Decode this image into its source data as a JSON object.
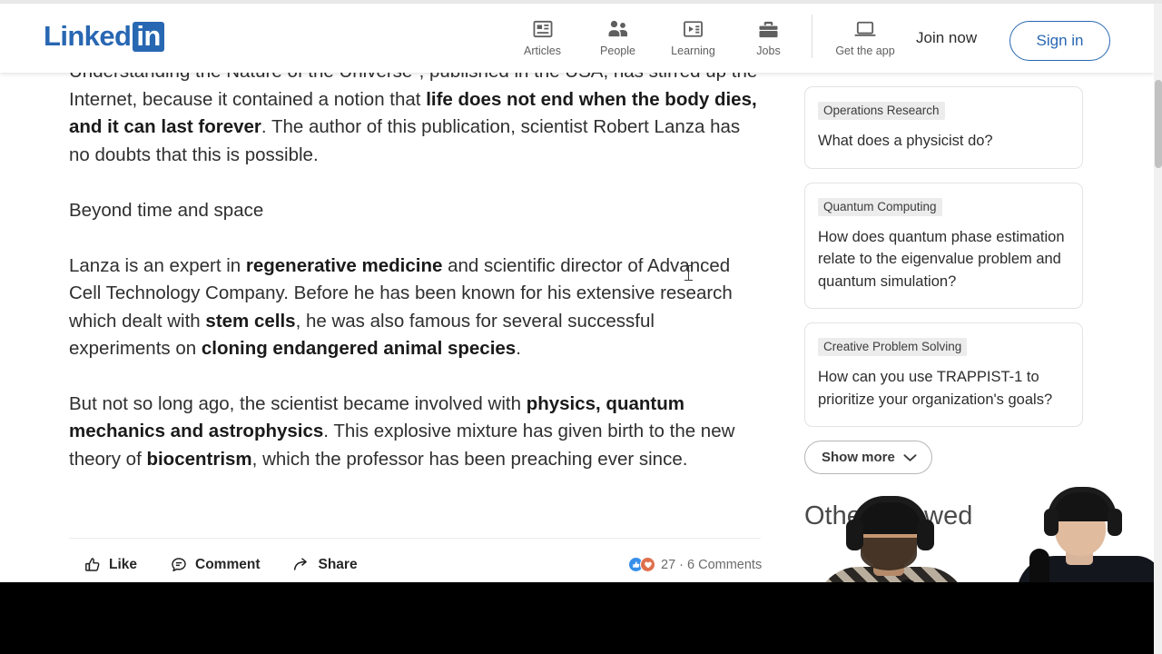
{
  "brand": {
    "word": "Linked",
    "badge": "in"
  },
  "nav": {
    "items": [
      {
        "label": "Articles",
        "icon": "articles-icon"
      },
      {
        "label": "People",
        "icon": "people-icon"
      },
      {
        "label": "Learning",
        "icon": "learning-icon"
      },
      {
        "label": "Jobs",
        "icon": "jobs-icon"
      }
    ],
    "get_the_app": {
      "label": "Get the app",
      "icon": "laptop-icon"
    },
    "join_now": "Join now",
    "sign_in": "Sign in"
  },
  "article": {
    "paragraph_1": {
      "part_1": "Understanding the Nature of the Universe\", published in the USA, has stirred up the Internet, because it contained a notion that ",
      "bold_1": "life does not end when the body dies, and it can last forever",
      "part_2": ". The author of this publication, scientist Robert Lanza has no doubts that this is possible."
    },
    "heading": "Beyond time and space",
    "paragraph_2": {
      "part_1": "Lanza is an expert in ",
      "bold_1": "regenerative medicine",
      "part_2": " and scientific director of Advanced Cell Technology Company. Before he has been known for his extensive research which dealt with ",
      "bold_2": "stem cells",
      "part_3": ", he was also famous for several successful experiments on ",
      "bold_3": "cloning endangered animal species",
      "part_4": "."
    },
    "paragraph_3": {
      "part_1": "But not so long ago, the scientist became involved with ",
      "bold_1": "physics, quantum mechanics and astrophysics",
      "part_2": ". This explosive mixture has given birth to the new theory of ",
      "bold_2": "biocentrism",
      "part_3": ", which the professor has been preaching ever since."
    }
  },
  "actions": {
    "like": "Like",
    "comment": "Comment",
    "share": "Share",
    "reaction_summary": "27 · 6 Comments"
  },
  "rail": {
    "cards": [
      {
        "tag": "Operations Research",
        "question": "What does a physicist do?"
      },
      {
        "tag": "Quantum Computing",
        "question": "How does quantum phase estimation relate to the eigenvalue problem and quantum simulation?"
      },
      {
        "tag": "Creative Problem Solving",
        "question": "How can you use TRAPPIST-1 to prioritize your organization's goals?"
      }
    ],
    "show_more": "Show more",
    "others_viewed": "Others viewed"
  },
  "colors": {
    "linkedin_blue": "#2867B2",
    "like_blue": "#378fe9",
    "heart_red": "#df704d",
    "tag_bg": "#ececec",
    "text": "#2f2f2f"
  }
}
